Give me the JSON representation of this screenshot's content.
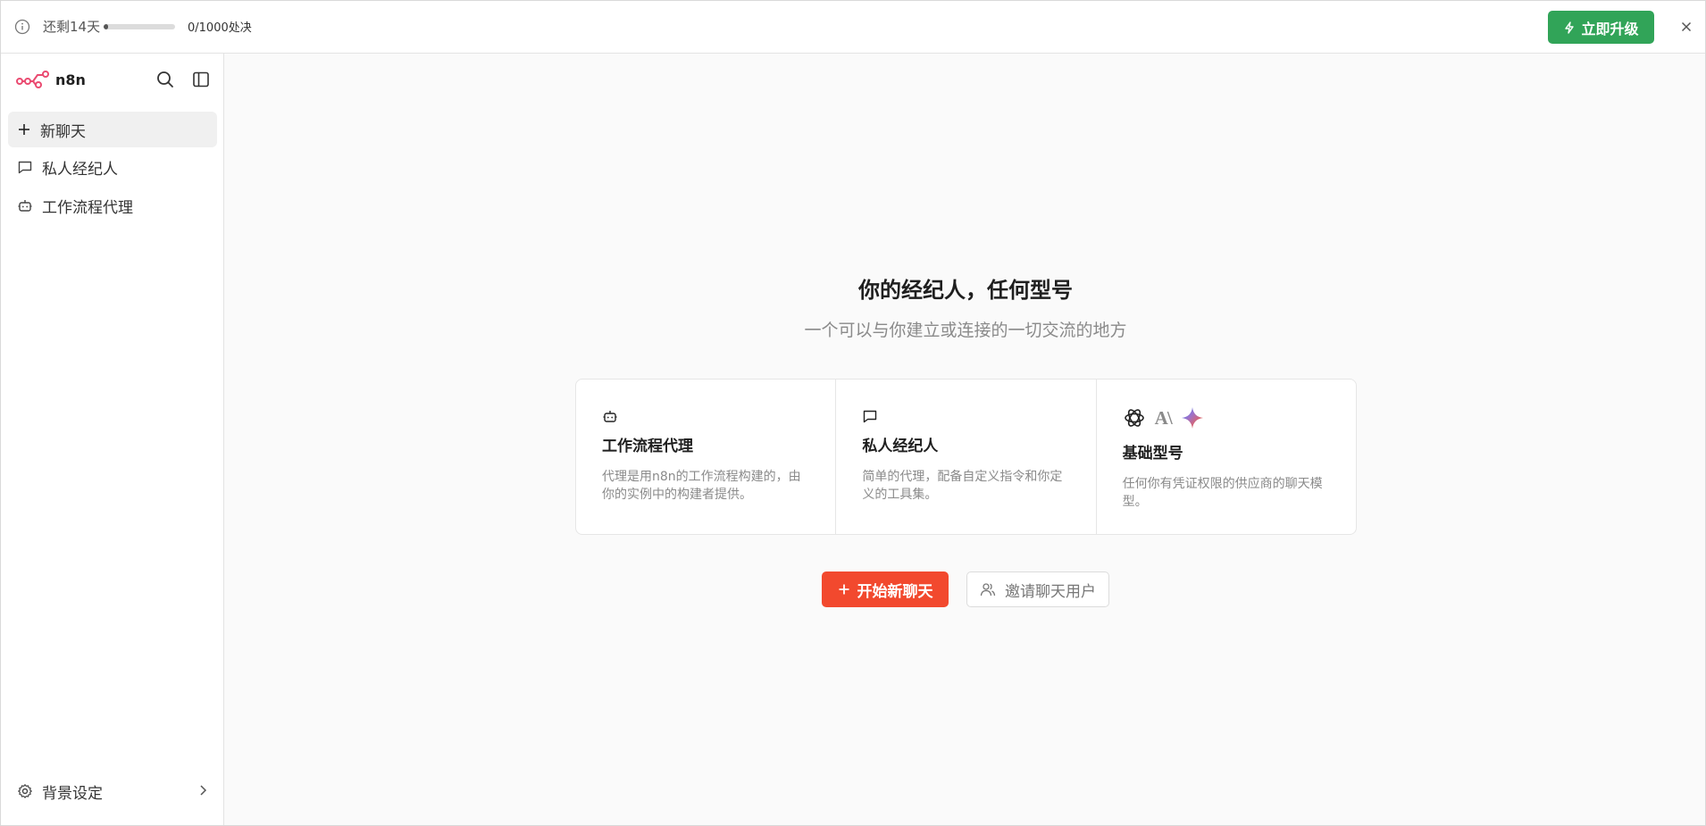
{
  "banner": {
    "trial_text": "还剩14天",
    "trial_progress_fraction": 0.06,
    "executions_text": "0/1000处决",
    "upgrade_label": "立即升级",
    "upgrade_color": "#31a458"
  },
  "sidebar": {
    "logo_text": "n8n",
    "brand_color": "#ea4b71",
    "items": [
      {
        "label": "新聊天",
        "icon": "plus-icon",
        "active": true
      },
      {
        "label": "私人经纪人",
        "icon": "message-icon",
        "active": false
      },
      {
        "label": "工作流程代理",
        "icon": "bot-icon",
        "active": false
      }
    ],
    "settings_label": "背景设定"
  },
  "main": {
    "title": "你的经纪人，任何型号",
    "subtitle": "一个可以与你建立或连接的一切交流的地方",
    "cards": [
      {
        "icon": "bot-icon",
        "title": "工作流程代理",
        "description": "代理是用n8n的工作流程构建的，由你的实例中的构建者提供。"
      },
      {
        "icon": "message-icon",
        "title": "私人经纪人",
        "description": "简单的代理，配备自定义指令和你定义的工具集。"
      },
      {
        "icon": "model-provider-icons",
        "title": "基础型号",
        "description": "任何你有凭证权限的供应商的聊天模型。",
        "provider_badge": "A\\"
      }
    ],
    "start_button_label": "开始新聊天",
    "start_button_color": "#f2492e",
    "invite_button_label": "邀请聊天用户"
  }
}
